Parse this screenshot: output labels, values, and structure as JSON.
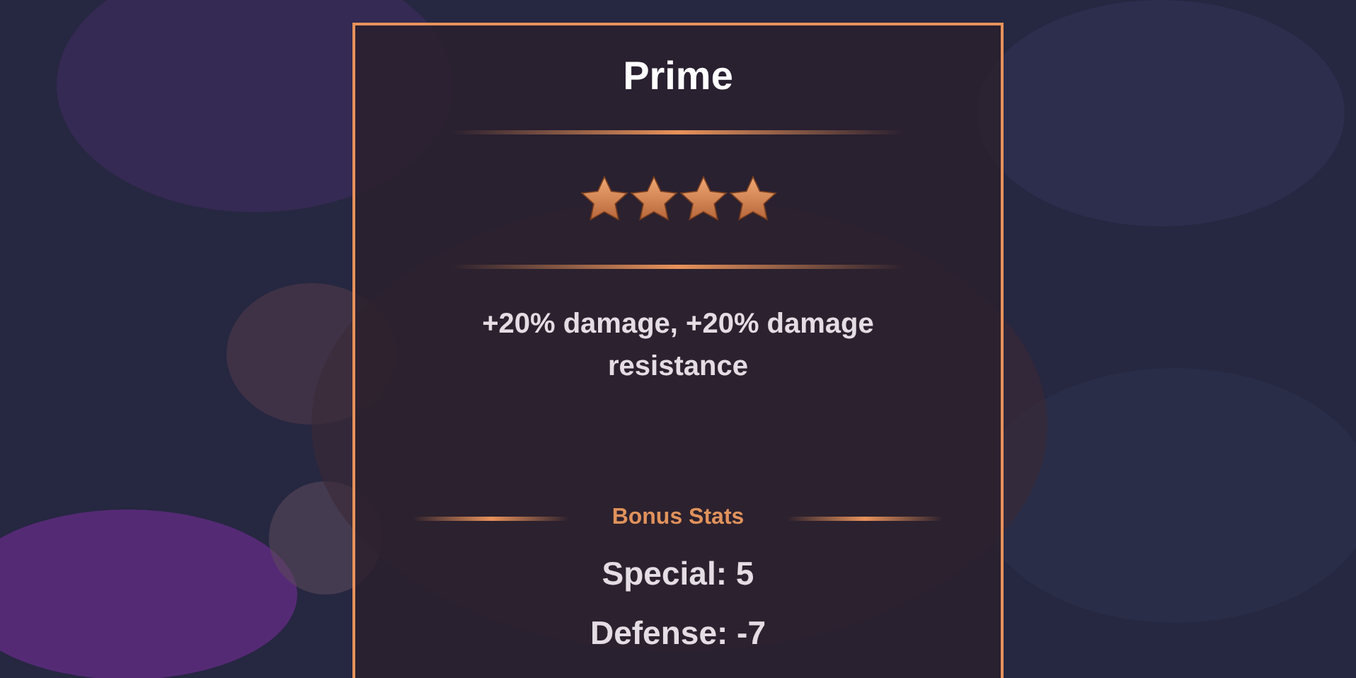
{
  "card": {
    "title": "Prime",
    "stars": 4,
    "description": "+20% damage, +20% damage resistance",
    "bonus_stats": {
      "heading": "Bonus Stats",
      "items": [
        "Special: 5",
        "Defense: -7"
      ]
    }
  }
}
